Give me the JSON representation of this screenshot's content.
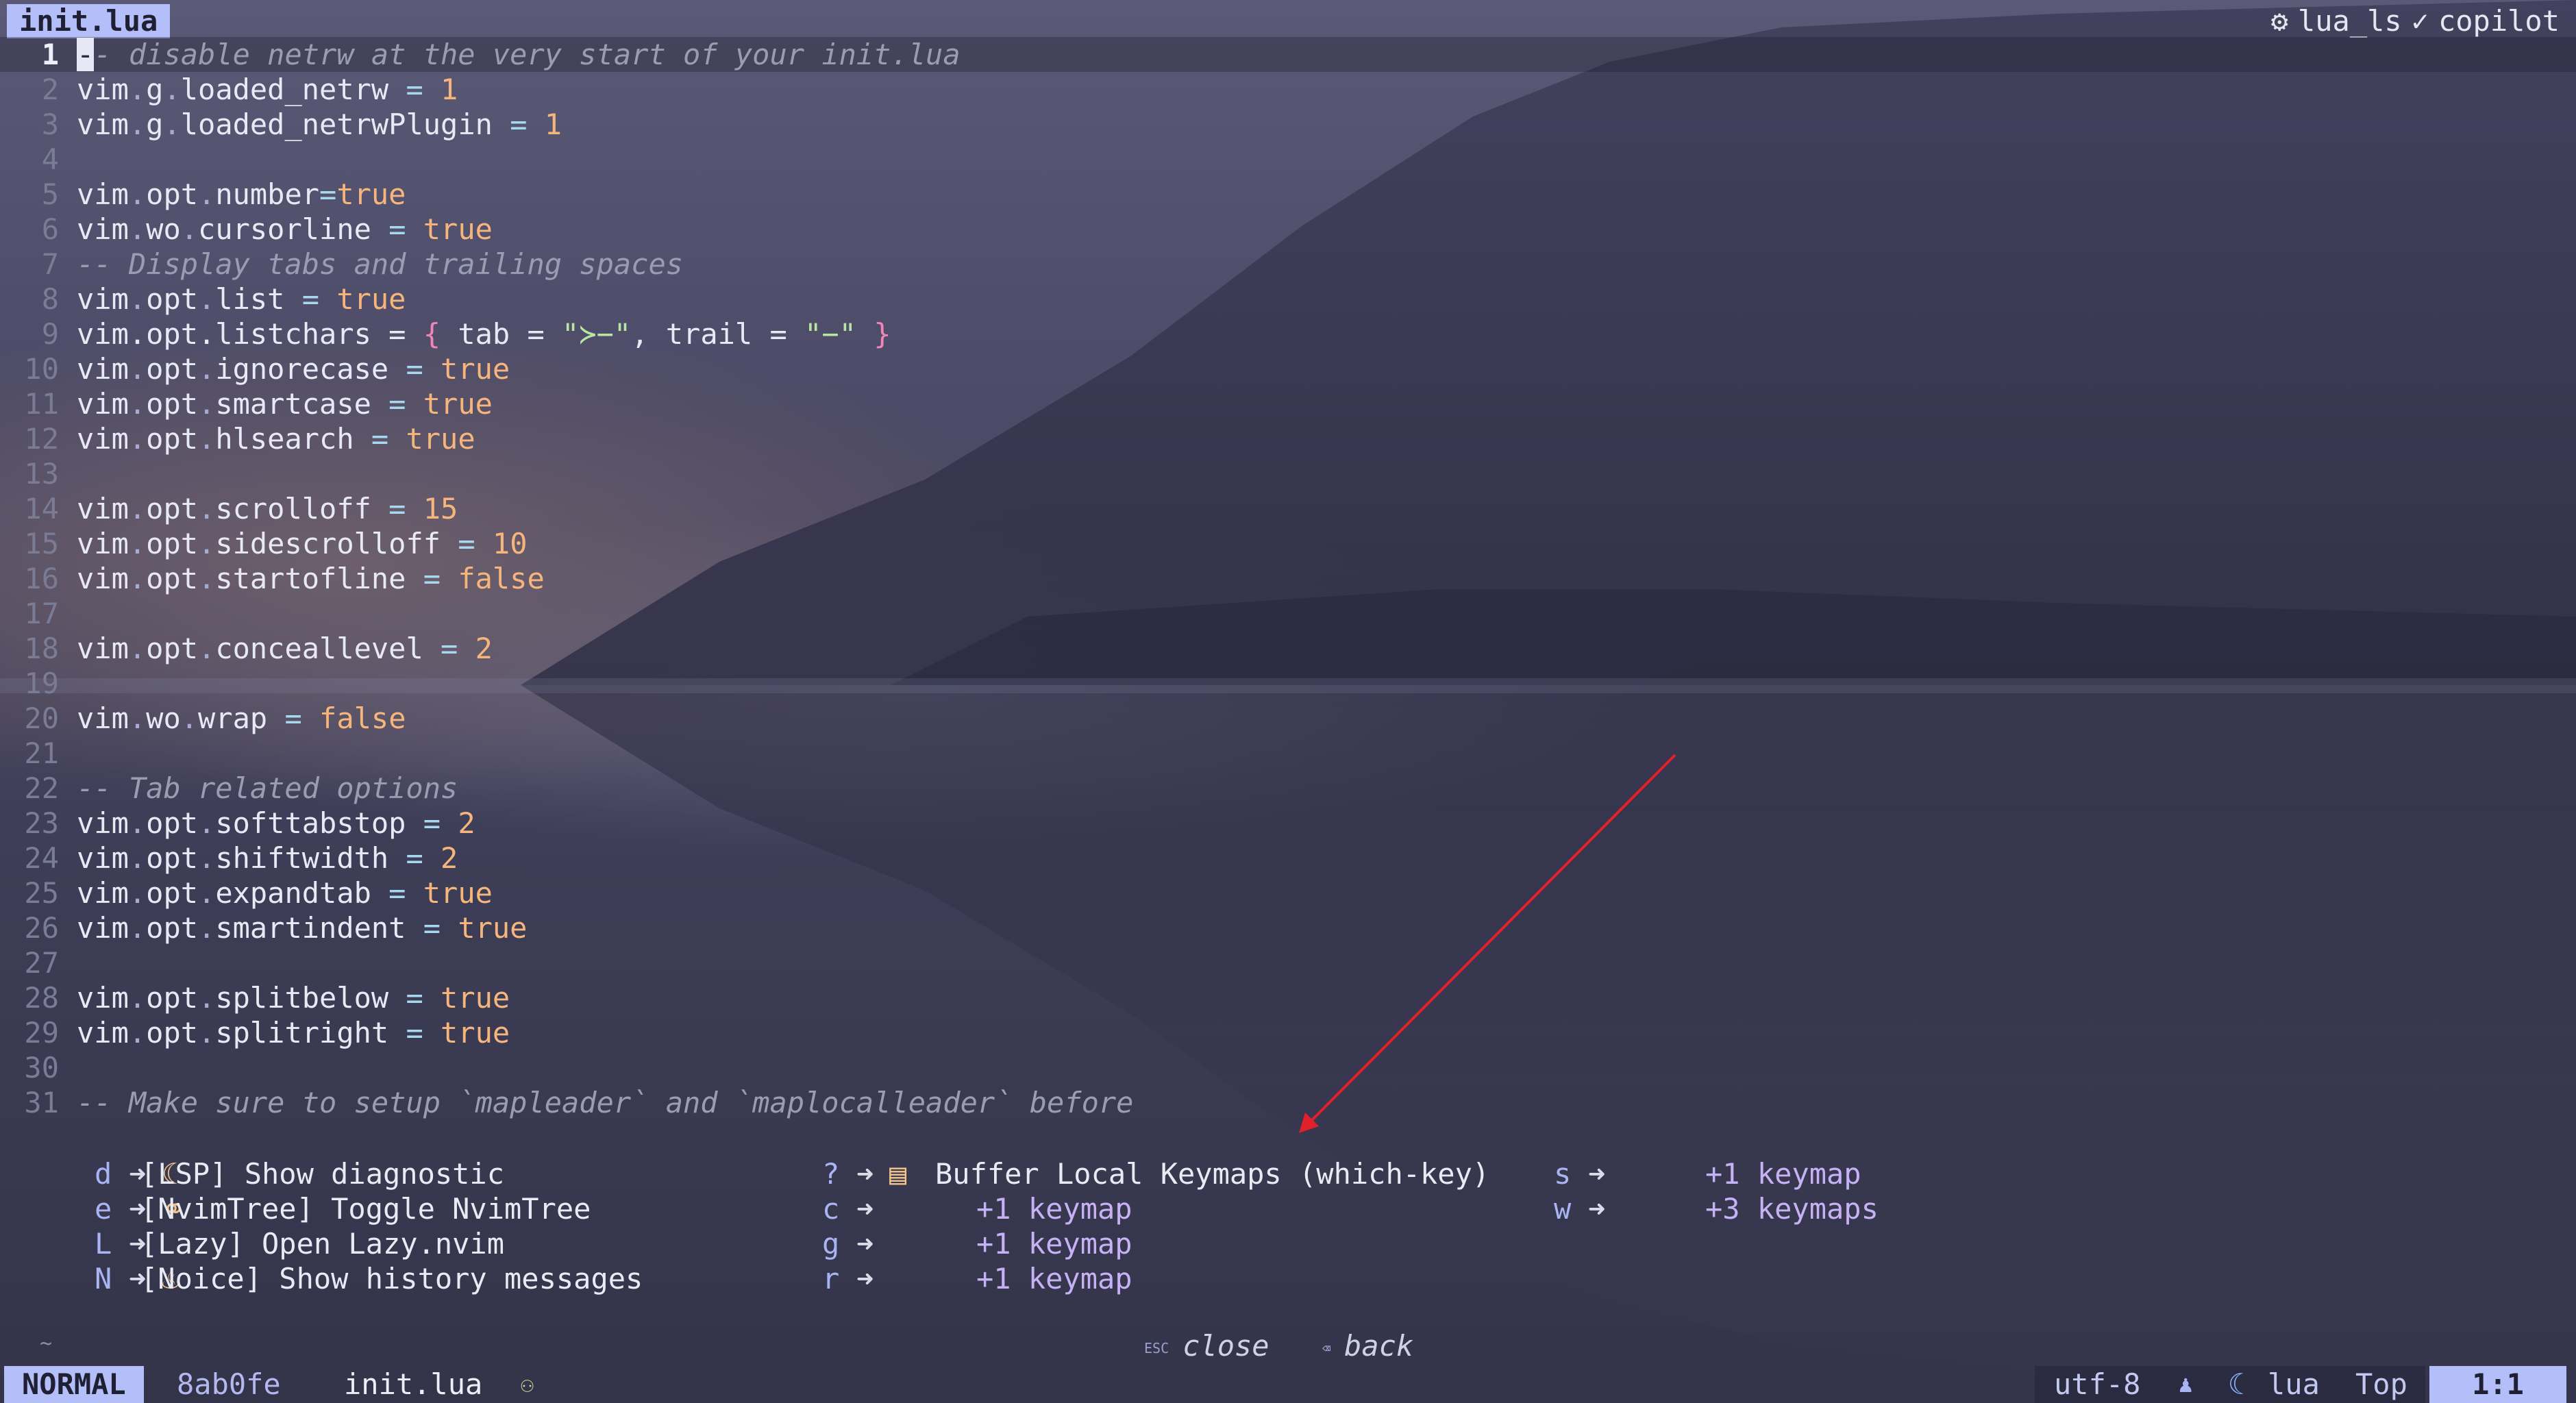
{
  "tabline": {
    "active_tab": "init.lua",
    "right_gear": "⚙",
    "lsp": "lua_ls",
    "check": "✓",
    "copilot": "copilot"
  },
  "code_lines": [
    {
      "n": "1"
    },
    {
      "n": "2"
    },
    {
      "n": "3"
    },
    {
      "n": "4"
    },
    {
      "n": "5"
    },
    {
      "n": "6"
    },
    {
      "n": "7"
    },
    {
      "n": "8"
    },
    {
      "n": "9"
    },
    {
      "n": "10"
    },
    {
      "n": "11"
    },
    {
      "n": "12"
    },
    {
      "n": "13"
    },
    {
      "n": "14"
    },
    {
      "n": "15"
    },
    {
      "n": "16"
    },
    {
      "n": "17"
    },
    {
      "n": "18"
    },
    {
      "n": "19"
    },
    {
      "n": "20"
    },
    {
      "n": "21"
    },
    {
      "n": "22"
    },
    {
      "n": "23"
    },
    {
      "n": "24"
    },
    {
      "n": "25"
    },
    {
      "n": "26"
    },
    {
      "n": "27"
    },
    {
      "n": "28"
    },
    {
      "n": "29"
    },
    {
      "n": "30"
    },
    {
      "n": "31"
    }
  ],
  "code_text": {
    "l1_cursor": "-",
    "l1": "- disable netrw at the very start of your init.lua",
    "l2": [
      "vim",
      ".",
      "g",
      ".",
      "loaded_netrw",
      " = ",
      "1"
    ],
    "l3": [
      "vim",
      ".",
      "g",
      ".",
      "loaded_netrwPlugin",
      " = ",
      "1"
    ],
    "l5": [
      "vim",
      ".",
      "opt",
      ".",
      "number",
      "=",
      "true"
    ],
    "l6": [
      "vim",
      ".",
      "wo",
      ".",
      "cursorline",
      " = ",
      "true"
    ],
    "l7": "-- Display tabs and trailing spaces",
    "l8": [
      "vim",
      ".",
      "opt",
      ".",
      "list",
      " = ",
      "true"
    ],
    "l9": {
      "pre": "vim.opt.listchars = ",
      "brace_open": "{",
      "mid1": " tab = ",
      "str1": "\"≻−\"",
      "mid2": ", trail = ",
      "str2": "\"−\"",
      "brace_close": " }"
    },
    "l10": [
      "vim",
      ".",
      "opt",
      ".",
      "ignorecase",
      " = ",
      "true"
    ],
    "l11": [
      "vim",
      ".",
      "opt",
      ".",
      "smartcase",
      " = ",
      "true"
    ],
    "l12": [
      "vim",
      ".",
      "opt",
      ".",
      "hlsearch",
      " = ",
      "true"
    ],
    "l14": [
      "vim",
      ".",
      "opt",
      ".",
      "scrolloff",
      " = ",
      "15"
    ],
    "l15": [
      "vim",
      ".",
      "opt",
      ".",
      "sidescrolloff",
      " = ",
      "10"
    ],
    "l16": [
      "vim",
      ".",
      "opt",
      ".",
      "startofline",
      " = ",
      "false"
    ],
    "l18": [
      "vim",
      ".",
      "opt",
      ".",
      "conceallevel",
      " = ",
      "2"
    ],
    "l20": [
      "vim",
      ".",
      "wo",
      ".",
      "wrap",
      " = ",
      "false"
    ],
    "l22": "-- Tab related options",
    "l23": [
      "vim",
      ".",
      "opt",
      ".",
      "softtabstop",
      " = ",
      "2"
    ],
    "l24": [
      "vim",
      ".",
      "opt",
      ".",
      "shiftwidth",
      " = ",
      "2"
    ],
    "l25": [
      "vim",
      ".",
      "opt",
      ".",
      "expandtab",
      " = ",
      "true"
    ],
    "l26": [
      "vim",
      ".",
      "opt",
      ".",
      "smartindent",
      " = ",
      "true"
    ],
    "l28": [
      "vim",
      ".",
      "opt",
      ".",
      "splitbelow",
      " = ",
      "true"
    ],
    "l29": [
      "vim",
      ".",
      "opt",
      ".",
      "splitright",
      " = ",
      "true"
    ],
    "l31": "-- Make sure to setup `mapleader` and `maplocalleader` before"
  },
  "whichkey": {
    "col1": [
      {
        "key": "d",
        "arrow": "➜",
        "icon": "☾",
        "desc": "[LSP] Show diagnostic"
      },
      {
        "key": "e",
        "arrow": "➜",
        "icon": "⚭",
        "desc": "[NvimTree] Toggle NvimTree"
      },
      {
        "key": "L",
        "arrow": "➜",
        "icon": " ",
        "desc": "[Lazy] Open Lazy.nvim"
      },
      {
        "key": "N",
        "arrow": "➜",
        "icon": "♨",
        "desc": "[Noice] Show history messages"
      }
    ],
    "col2": [
      {
        "key": "?",
        "arrow": "➜",
        "icon": "▤",
        "desc": "Buffer Local Keymaps (which-key)"
      },
      {
        "key": "c",
        "arrow": "➜",
        "icon": " ",
        "desc": "+1 keymap"
      },
      {
        "key": "g",
        "arrow": "➜",
        "icon": " ",
        "desc": "+1 keymap"
      },
      {
        "key": "r",
        "arrow": "➜",
        "icon": " ",
        "desc": "+1 keymap"
      }
    ],
    "col3": [
      {
        "key": "s",
        "arrow": "➜",
        "icon": " ",
        "desc": "+1 keymap"
      },
      {
        "key": "w",
        "arrow": "➜",
        "icon": " ",
        "desc": "+3 keymaps"
      }
    ],
    "hint_esc_key": "ESC",
    "hint_close": "close",
    "hint_back_key": "⌫",
    "hint_back": "back"
  },
  "statusline": {
    "mode": "NORMAL",
    "branch_icon": "",
    "branch": "8ab0fe",
    "file": "init.lua",
    "file_icon": "⚇",
    "encoding": "utf-8",
    "os_icon": "♟",
    "ft_icon": "☾",
    "filetype": "lua",
    "scroll": "Top",
    "position": "1:1"
  },
  "tilde": "~",
  "colors": {
    "accent": "#b4bef8",
    "boolean": "#f6b57c",
    "string": "#b8e6a0",
    "brace": "#ef86b7",
    "comment": "#9a9cb2",
    "annotation_arrow": "#e0202a"
  }
}
